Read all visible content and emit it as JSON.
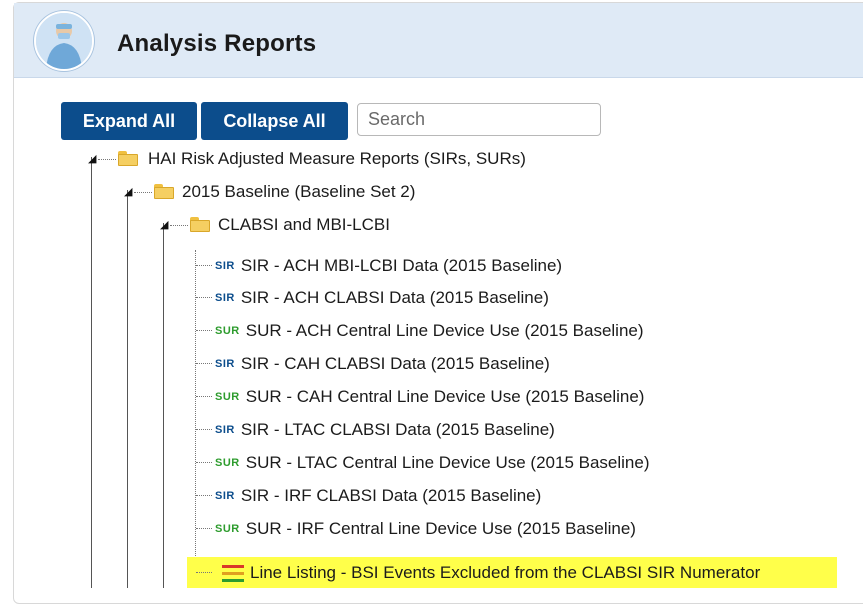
{
  "header": {
    "title": "Analysis Reports"
  },
  "toolbar": {
    "expand_label": "Expand All",
    "collapse_label": "Collapse All",
    "search_placeholder": "Search"
  },
  "colors": {
    "header_bg": "#dfeaf6",
    "button_bg": "#0c4d8c",
    "sir_badge": "#0c4d8c",
    "sur_badge": "#2e9c2e",
    "highlight": "#ffff4a"
  },
  "tree": {
    "root": {
      "icon": "folder-icon",
      "label": "HAI Risk Adjusted Measure Reports (SIRs, SURs)"
    },
    "baseline": {
      "icon": "folder-icon",
      "label": "2015 Baseline (Baseline Set 2)"
    },
    "clabsi": {
      "icon": "folder-icon",
      "label": "CLABSI and MBI-LCBI"
    },
    "items": [
      {
        "badge": "SIR",
        "label": "SIR - ACH MBI-LCBI Data (2015 Baseline)"
      },
      {
        "badge": "SIR",
        "label": "SIR - ACH CLABSI Data (2015 Baseline)"
      },
      {
        "badge": "SUR",
        "label": "SUR - ACH Central Line Device Use (2015 Baseline)"
      },
      {
        "badge": "SIR",
        "label": "SIR - CAH CLABSI Data (2015 Baseline)"
      },
      {
        "badge": "SUR",
        "label": "SUR - CAH Central Line Device Use (2015 Baseline)"
      },
      {
        "badge": "SIR",
        "label": "SIR - LTAC CLABSI Data (2015 Baseline)"
      },
      {
        "badge": "SUR",
        "label": "SUR - LTAC Central Line Device Use (2015 Baseline)"
      },
      {
        "badge": "SIR",
        "label": "SIR - IRF CLABSI Data (2015 Baseline)"
      },
      {
        "badge": "SUR",
        "label": "SUR - IRF Central Line Device Use (2015 Baseline)"
      }
    ],
    "line_listing": {
      "icon": "line-listing-icon",
      "label": "Line Listing - BSI Events Excluded from the CLABSI SIR Numerator"
    }
  }
}
